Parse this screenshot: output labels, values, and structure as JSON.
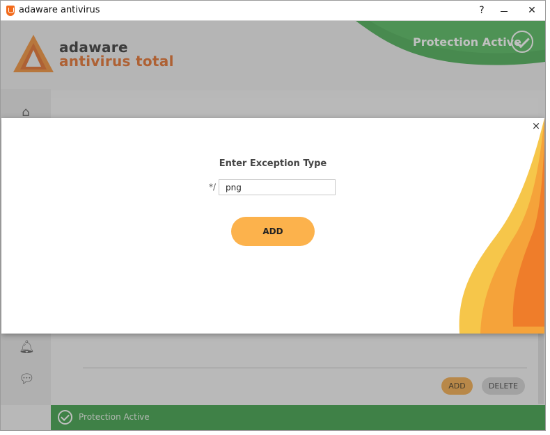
{
  "window": {
    "title": "adaware antivirus",
    "help_glyph": "?",
    "close_glyph": "✕"
  },
  "brand": {
    "line1": "adaware",
    "line2": "antivirus total"
  },
  "header": {
    "status_text": "Protection Active"
  },
  "content": {
    "add_label": "ADD",
    "delete_label": "DELETE"
  },
  "statusbar": {
    "text": "Protection Active"
  },
  "modal": {
    "title": "Enter Exception Type",
    "prefix": "*/",
    "input_value": "png",
    "add_label": "ADD",
    "close_glyph": "×"
  },
  "colors": {
    "accent_orange": "#fcb24c",
    "brand_orange": "#e3661d",
    "status_green": "#2f9a3c"
  },
  "icons": [
    "app-icon",
    "home-icon",
    "bell-icon",
    "chat-icon",
    "check-circle-icon",
    "close-icon",
    "help-icon",
    "minimize-icon"
  ]
}
